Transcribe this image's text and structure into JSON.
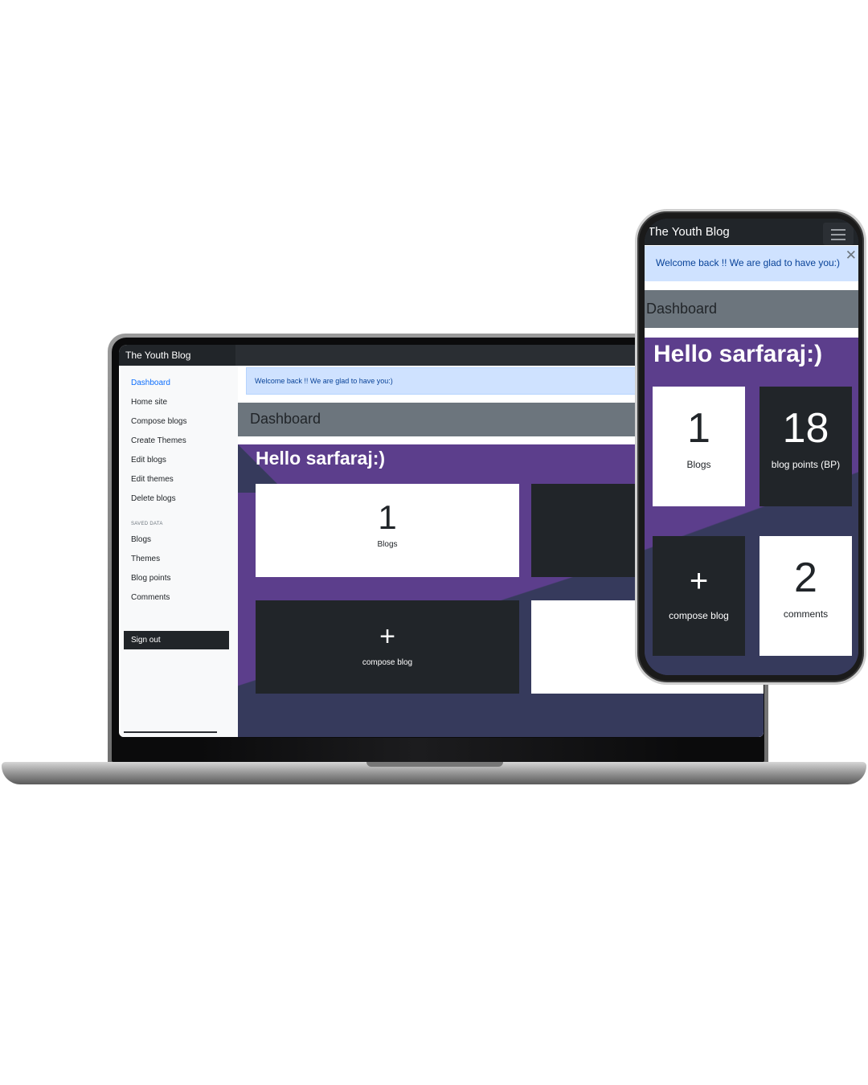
{
  "brand": "The Youth Blog",
  "phone_brand": "The Youth Blog",
  "sidebar": {
    "items": [
      {
        "label": "Dashboard",
        "active": true
      },
      {
        "label": "Home site"
      },
      {
        "label": "Compose blogs"
      },
      {
        "label": "Create Themes"
      },
      {
        "label": "Edit blogs"
      },
      {
        "label": "Edit themes"
      },
      {
        "label": "Delete blogs"
      }
    ],
    "saved_heading": "SAVED DATA",
    "saved_items": [
      {
        "label": "Blogs"
      },
      {
        "label": "Themes"
      },
      {
        "label": "Blog points"
      },
      {
        "label": "Comments"
      }
    ],
    "sign_out": "Sign out"
  },
  "alert": {
    "text": "Welcome back !! We are glad to have you:)",
    "close": "✕"
  },
  "dashboard": {
    "title": "Dashboard",
    "greeting": "Hello sarfaraj:)",
    "cards": {
      "blogs": {
        "value": "1",
        "label": "Blogs"
      },
      "blog_points": {
        "value": "18",
        "label": "blog points (BP)"
      },
      "compose": {
        "icon": "+",
        "label": "compose blog"
      },
      "comments": {
        "value": "2",
        "label": "comments"
      }
    }
  },
  "colors": {
    "navbar": "#212529",
    "purple": "#5c3e8c",
    "navy": "#363a5c",
    "alert_bg": "#cfe2ff",
    "alert_text": "#084298",
    "dash_bg": "#6c757d",
    "link_active": "#0d6efd"
  }
}
